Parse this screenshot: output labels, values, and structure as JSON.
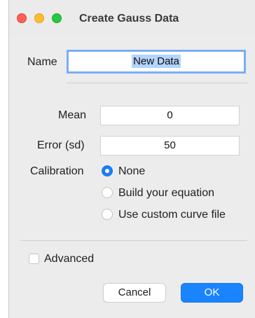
{
  "window": {
    "title": "Create Gauss Data"
  },
  "form": {
    "name_label": "Name",
    "name_value": "New Data",
    "mean_label": "Mean",
    "mean_value": "0",
    "error_label": "Error (sd)",
    "error_value": "50",
    "calibration_label": "Calibration",
    "calibration_options": [
      {
        "label": "None",
        "selected": true
      },
      {
        "label": "Build your equation",
        "selected": false
      },
      {
        "label": "Use custom curve file",
        "selected": false
      }
    ],
    "advanced_label": "Advanced",
    "advanced_checked": false
  },
  "buttons": {
    "cancel": "Cancel",
    "ok": "OK"
  },
  "colors": {
    "accent": "#1a84ff",
    "close": "#fe5f57",
    "minimize": "#febc2e",
    "maximize": "#28c840"
  }
}
